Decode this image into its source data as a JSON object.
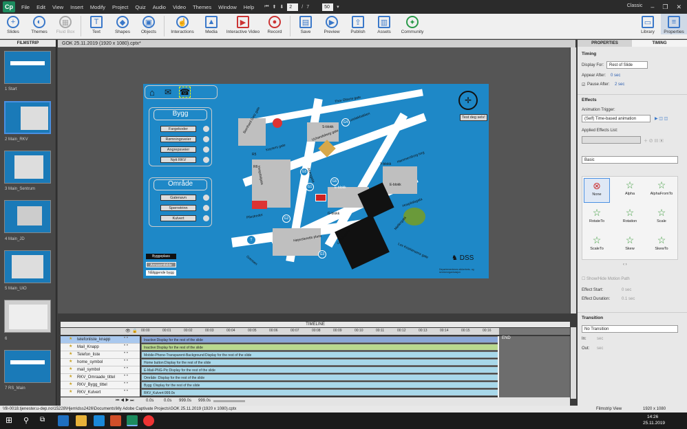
{
  "app": {
    "logo": "Cp",
    "workspace": "Classic"
  },
  "menu": [
    "File",
    "Edit",
    "View",
    "Insert",
    "Modify",
    "Project",
    "Quiz",
    "Audio",
    "Video",
    "Themes",
    "Window",
    "Help"
  ],
  "nav": {
    "current": "2",
    "sep": "/",
    "total": "7",
    "zoom": "50"
  },
  "toolbar": [
    {
      "label": "Slides",
      "icon": "plus-icon",
      "enabled": true
    },
    {
      "label": "Themes",
      "icon": "themes-icon",
      "enabled": true
    },
    {
      "label": "Fluid Box",
      "icon": "fluid-box-icon",
      "enabled": false
    },
    {
      "label": "Text",
      "icon": "text-icon",
      "enabled": true
    },
    {
      "label": "Shapes",
      "icon": "shapes-icon",
      "enabled": true
    },
    {
      "label": "Objects",
      "icon": "objects-icon",
      "enabled": true
    },
    {
      "label": "Interactions",
      "icon": "hand-pointer-icon",
      "enabled": true
    },
    {
      "label": "Media",
      "icon": "media-icon",
      "enabled": true
    },
    {
      "label": "Interactive Video",
      "icon": "video-icon",
      "enabled": true
    },
    {
      "label": "Record",
      "icon": "record-icon",
      "enabled": true
    },
    {
      "label": "Save",
      "icon": "save-icon",
      "enabled": true
    },
    {
      "label": "Preview",
      "icon": "preview-icon",
      "enabled": true
    },
    {
      "label": "Publish",
      "icon": "publish-icon",
      "enabled": true
    },
    {
      "label": "Assets",
      "icon": "assets-icon",
      "enabled": true
    },
    {
      "label": "Community",
      "icon": "community-icon",
      "enabled": true
    },
    {
      "label": "Library",
      "icon": "library-icon",
      "enabled": true
    },
    {
      "label": "Properties",
      "icon": "properties-icon",
      "enabled": true
    }
  ],
  "filmstrip": {
    "title": "FILMSTRIP",
    "slides": [
      "1 Start",
      "2 Main_RKV",
      "3 Main_Sentrum",
      "4 Main_JD",
      "5 Main_UiO",
      "6",
      "7 RS_Main"
    ]
  },
  "document": {
    "tab": "GOK 25.11.2019 (1920 x 1080).cptx*"
  },
  "slide": {
    "bygg_title": "Bygg",
    "bygg_buttons": [
      "Fargekoder",
      "Rømningsveier",
      "Angrepsveier",
      "Nytt RKV"
    ],
    "omrade_title": "Område",
    "omrade_buttons": [
      "Gatenavn",
      "Sperretrinn",
      "Kulvert"
    ],
    "legend": [
      "Byggeplass",
      "Annasentbilde",
      "Nåliggende bygg"
    ],
    "test_button": "Test deg selv!",
    "streets": [
      "Thor Olsens gate",
      "Bernhard Getz gate",
      "Ruseløkbakken",
      "Keysers gate",
      "Uchandsberg gate",
      "Hammersborg torg",
      "Akersgata",
      "Hospitalgata",
      "Hospitalsgata",
      "Møllergata",
      "Pilestredet",
      "Høyesteretts plass",
      "Grubbegata",
      "Lov Kristiansens gate",
      "Grensen",
      "Teatergata"
    ],
    "blocks": [
      "E-blokk",
      "E-blokk",
      "G-blokk",
      "R5",
      "R6",
      "Y-blokk",
      "S-blokk"
    ],
    "gates": [
      "G1",
      "G2",
      "G3",
      "G4",
      "G5",
      "G6"
    ],
    "brand": "DSS",
    "brand_sub": "Departementenes sikkerhets- og serviceorganisasjon"
  },
  "timeline": {
    "title": "TIMELINE",
    "ticks": [
      "00:00",
      "00:01",
      "00:02",
      "00:03",
      "00:04",
      "00:05",
      "00:06",
      "00:07",
      "00:08",
      "00:09",
      "00:10",
      "00:11",
      "00:12",
      "00:13",
      "00:14",
      "00:15",
      "00:16",
      "00:17",
      "00:18",
      "00:19"
    ],
    "end": "END",
    "rows": [
      {
        "name": "telefonliste_knapp",
        "bar": "Inactive:Display for the rest of the slide",
        "color": "#8aa7d8",
        "selected": true
      },
      {
        "name": "Mail_Knapp",
        "bar": "Inactive:Display for the rest of the slide",
        "color": "#b9d98f"
      },
      {
        "name": "Telefon_liste",
        "bar": "Mobile-Phone-Transparent-Background:Display for the rest of the slide",
        "color": "#a8d8ea"
      },
      {
        "name": "home_symbol",
        "bar": "Home button:Display for the rest of the slide",
        "color": "#a8d8ea"
      },
      {
        "name": "mail_symbol",
        "bar": "E-Mail-PNG-Pic:Display for the rest of the slide",
        "color": "#a8d8ea"
      },
      {
        "name": "RKV_Omraade_tittel",
        "bar": "Område :Display for the rest of the slide",
        "color": "#a8d8ea"
      },
      {
        "name": "RKV_Bygg_tittel",
        "bar": "Bygg :Display for the rest of the slide",
        "color": "#a8d8ea"
      },
      {
        "name": "RKV_Kulvert",
        "bar": "RKV_Kulvert:999.0s",
        "color": "#a8d8ea"
      }
    ],
    "footer": [
      "0.0s",
      "0.0s",
      "999.0s",
      "999.0s"
    ]
  },
  "properties": {
    "tabs": [
      "PROPERTIES",
      "TIMING"
    ],
    "timing_title": "Timing",
    "display_for_label": "Display For:",
    "display_for_value": "Rest of Slide",
    "appear_after_label": "Appear After:",
    "appear_after_value": "0 sec",
    "pause_after_label": "Pause After:",
    "pause_after_value": "2 sec",
    "effects_title": "Effects",
    "anim_trigger_label": "Animation Trigger:",
    "anim_trigger_value": "(Self) Time-based animation",
    "applied_label": "Applied Effects List:",
    "category_value": "Basic",
    "effects": [
      "None",
      "Alpha",
      "AlphaFromTo",
      "RotateTo",
      "Rotation",
      "Scale",
      "ScaleTo",
      "Skew",
      "SkewTo"
    ],
    "motion_path": "Show/Hide Motion Path",
    "effect_start_label": "Effect Start:",
    "effect_start_value": "0 sec",
    "effect_duration_label": "Effect Duration:",
    "effect_duration_value": "0.1 sec",
    "transition_title": "Transition",
    "transition_value": "No Transition",
    "in_label": "In:",
    "in_value": "sec",
    "out_label": "Out:",
    "out_value": "sec"
  },
  "status": {
    "path": "\\\\fil-0018.tjenester.u-dep.no\\15228\\Hjem\\dss2426\\Documents\\My Adobe Captivate Projects\\GOK 25.11.2019 (1920 x 1080).cptx",
    "view": "Filmstrip View",
    "size": "1920 x 1080"
  },
  "taskbar": {
    "time": "14:26",
    "date": "25.11.2019"
  }
}
